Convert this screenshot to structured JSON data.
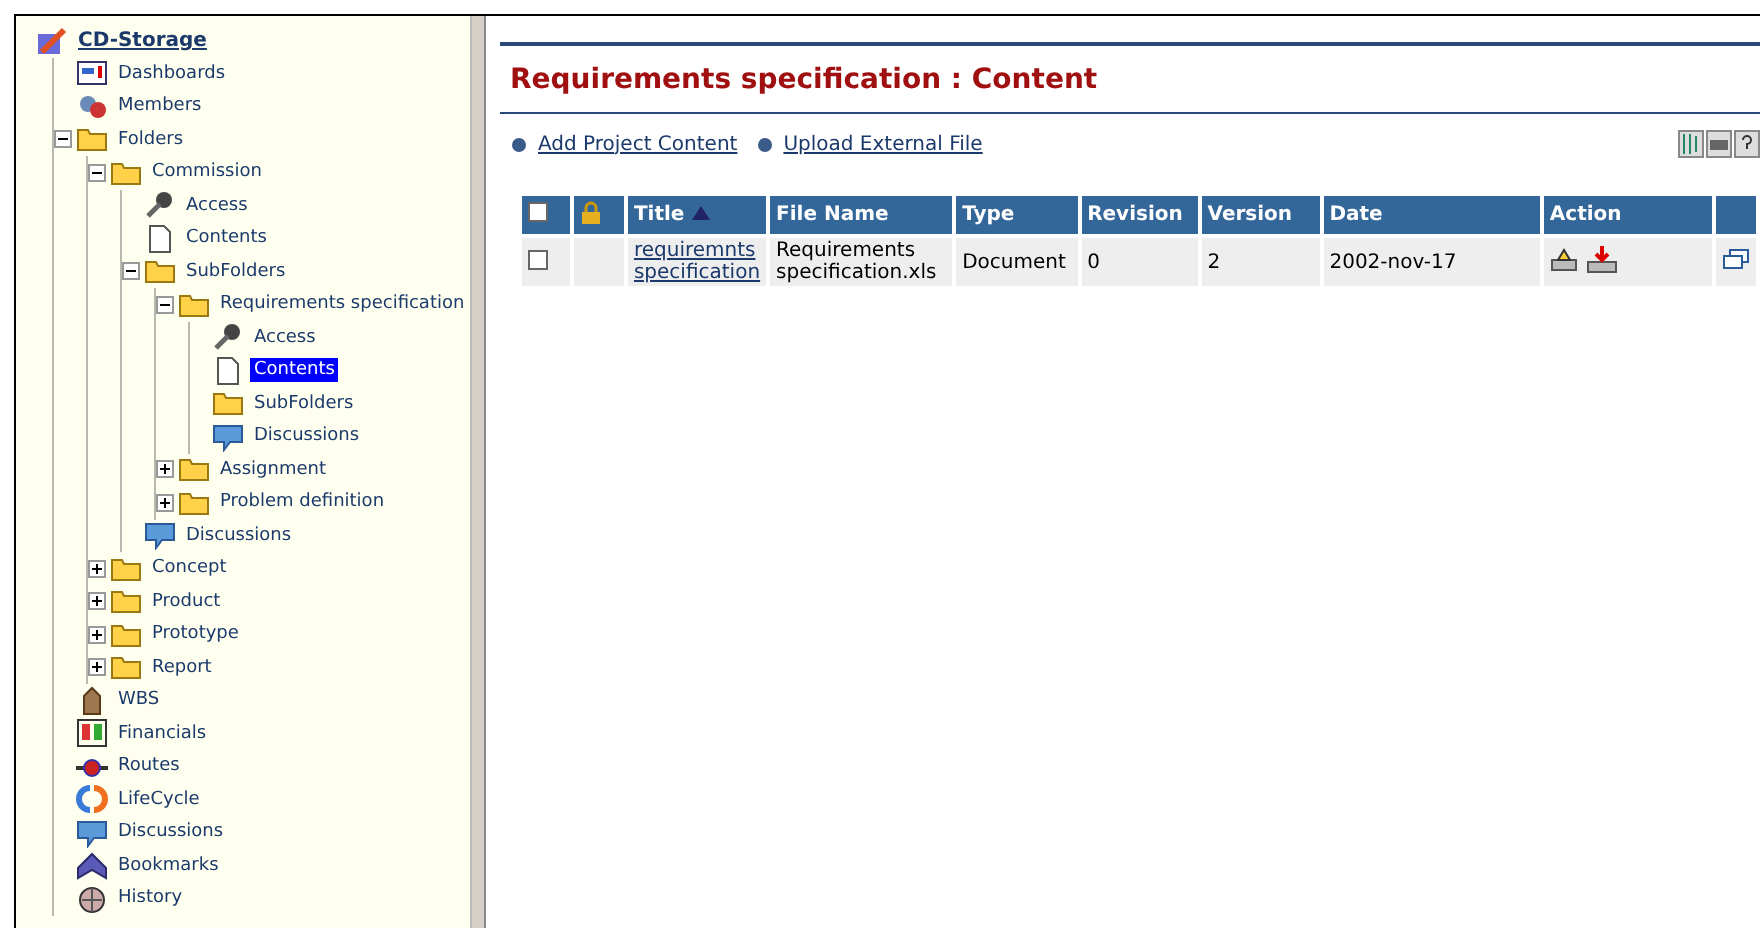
{
  "tree": {
    "root": {
      "label": "CD-Storage",
      "kind": "project"
    },
    "items": [
      {
        "label": "Dashboards",
        "kind": "dashboard"
      },
      {
        "label": "Members",
        "kind": "members"
      },
      {
        "label": "Folders",
        "kind": "folder",
        "expanded": true,
        "children": [
          {
            "label": "Commission",
            "kind": "folder",
            "expanded": true,
            "children": [
              {
                "label": "Access",
                "kind": "key"
              },
              {
                "label": "Contents",
                "kind": "doc",
                "selected": false
              },
              {
                "label": "SubFolders",
                "kind": "folder",
                "expanded": true,
                "children": [
                  {
                    "label": "Requirements specification",
                    "kind": "folder",
                    "expanded": true,
                    "children": [
                      {
                        "label": "Access",
                        "kind": "key"
                      },
                      {
                        "label": "Contents",
                        "kind": "doc",
                        "selected": true
                      },
                      {
                        "label": "SubFolders",
                        "kind": "folder"
                      },
                      {
                        "label": "Discussions",
                        "kind": "discussion"
                      }
                    ]
                  },
                  {
                    "label": "Assignment",
                    "kind": "folder",
                    "expanded": false
                  },
                  {
                    "label": "Problem definition",
                    "kind": "folder",
                    "expanded": false
                  }
                ]
              },
              {
                "label": "Discussions",
                "kind": "discussion"
              }
            ]
          },
          {
            "label": "Concept",
            "kind": "folder",
            "expanded": false
          },
          {
            "label": "Product",
            "kind": "folder",
            "expanded": false
          },
          {
            "label": "Prototype",
            "kind": "folder",
            "expanded": false
          },
          {
            "label": "Report",
            "kind": "folder",
            "expanded": false
          }
        ]
      },
      {
        "label": "WBS",
        "kind": "wbs"
      },
      {
        "label": "Financials",
        "kind": "financials"
      },
      {
        "label": "Routes",
        "kind": "routes"
      },
      {
        "label": "LifeCycle",
        "kind": "lifecycle"
      },
      {
        "label": "Discussions",
        "kind": "discussion"
      },
      {
        "label": "Bookmarks",
        "kind": "bookmark"
      },
      {
        "label": "History",
        "kind": "history"
      }
    ]
  },
  "page": {
    "title": "Requirements specification : Content",
    "links": [
      "Add Project Content",
      "Upload External File"
    ],
    "table": {
      "columns": [
        {
          "label": "Title",
          "sorted": true
        },
        {
          "label": "File Name",
          "sorted": false
        },
        {
          "label": "Type",
          "sorted": false
        },
        {
          "label": "Revision",
          "sorted": false
        },
        {
          "label": "Version",
          "sorted": false
        },
        {
          "label": "Date",
          "sorted": false
        },
        {
          "label": "Action",
          "sorted": false
        }
      ],
      "header_checked": false,
      "rows": [
        {
          "checked": false,
          "title": "requiremnts specification",
          "file_name": "Requirements specification.xls",
          "type": "Document",
          "revision": "0",
          "version": "2",
          "date": "2002-nov-17"
        }
      ]
    }
  }
}
